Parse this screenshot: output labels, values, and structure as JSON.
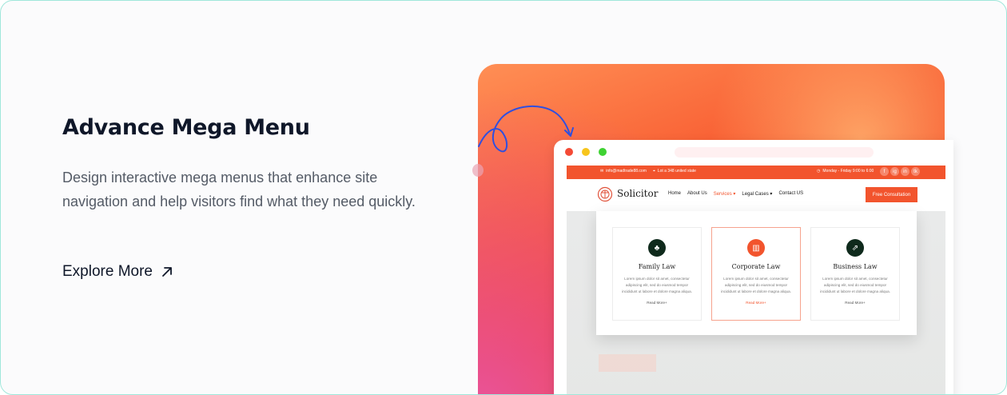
{
  "feature": {
    "title": "Advance Mega Menu",
    "description": "Design interactive mega menus that enhance site navigation and help visitors find what they need quickly.",
    "explore_label": "Explore More"
  },
  "mock": {
    "topbar": {
      "email": "info@madtrade88.com",
      "address": "Lot a 348 united state",
      "hours": "Monday - Friday 9:00 to 6:00",
      "socials": [
        "f",
        "ig",
        "in",
        "tk"
      ]
    },
    "brand": "Solicitor",
    "nav": [
      "Home",
      "About Us",
      "Services",
      "Legal Cases",
      "Contact US"
    ],
    "cta_label": "Free Consultation",
    "services": [
      {
        "title": "Family Law",
        "text": "Lorem ipsum dolor sit amet, consectetur adipiscing elit, sed do eiusmod tempor incididunt ut labore et dolore magna aliqua.",
        "link": "Read More+"
      },
      {
        "title": "Corporate Law",
        "text": "Lorem ipsum dolor sit amet, consectetur adipiscing elit, sed do eiusmod tempor incididunt ut labore et dolore magna aliqua.",
        "link": "Read More+"
      },
      {
        "title": "Business Law",
        "text": "Lorem ipsum dolor sit amet, consectetur adipiscing elit, sed do eiusmod tempor incididunt ut labore et dolore magna aliqua.",
        "link": "Read More+"
      }
    ]
  },
  "colors": {
    "accent": "#f2542d",
    "dark_icon": "#0f2a1c",
    "card_border": "#9fe7da"
  }
}
